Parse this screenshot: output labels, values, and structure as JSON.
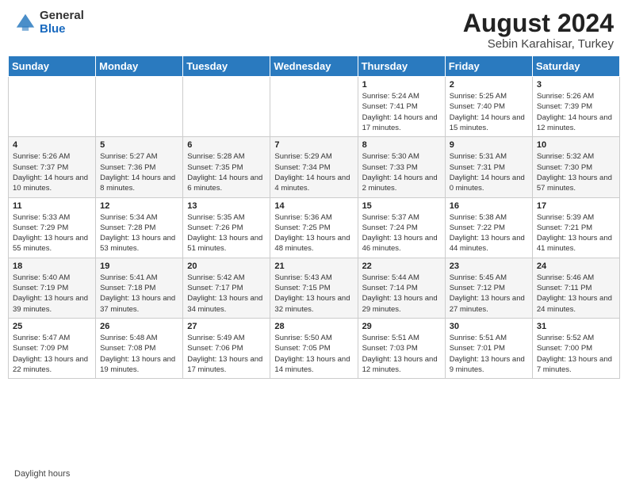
{
  "header": {
    "logo_general": "General",
    "logo_blue": "Blue",
    "month_year": "August 2024",
    "location": "Sebin Karahisar, Turkey"
  },
  "days_of_week": [
    "Sunday",
    "Monday",
    "Tuesday",
    "Wednesday",
    "Thursday",
    "Friday",
    "Saturday"
  ],
  "weeks": [
    [
      {
        "day": "",
        "info": ""
      },
      {
        "day": "",
        "info": ""
      },
      {
        "day": "",
        "info": ""
      },
      {
        "day": "",
        "info": ""
      },
      {
        "day": "1",
        "info": "Sunrise: 5:24 AM\nSunset: 7:41 PM\nDaylight: 14 hours and 17 minutes."
      },
      {
        "day": "2",
        "info": "Sunrise: 5:25 AM\nSunset: 7:40 PM\nDaylight: 14 hours and 15 minutes."
      },
      {
        "day": "3",
        "info": "Sunrise: 5:26 AM\nSunset: 7:39 PM\nDaylight: 14 hours and 12 minutes."
      }
    ],
    [
      {
        "day": "4",
        "info": "Sunrise: 5:26 AM\nSunset: 7:37 PM\nDaylight: 14 hours and 10 minutes."
      },
      {
        "day": "5",
        "info": "Sunrise: 5:27 AM\nSunset: 7:36 PM\nDaylight: 14 hours and 8 minutes."
      },
      {
        "day": "6",
        "info": "Sunrise: 5:28 AM\nSunset: 7:35 PM\nDaylight: 14 hours and 6 minutes."
      },
      {
        "day": "7",
        "info": "Sunrise: 5:29 AM\nSunset: 7:34 PM\nDaylight: 14 hours and 4 minutes."
      },
      {
        "day": "8",
        "info": "Sunrise: 5:30 AM\nSunset: 7:33 PM\nDaylight: 14 hours and 2 minutes."
      },
      {
        "day": "9",
        "info": "Sunrise: 5:31 AM\nSunset: 7:31 PM\nDaylight: 14 hours and 0 minutes."
      },
      {
        "day": "10",
        "info": "Sunrise: 5:32 AM\nSunset: 7:30 PM\nDaylight: 13 hours and 57 minutes."
      }
    ],
    [
      {
        "day": "11",
        "info": "Sunrise: 5:33 AM\nSunset: 7:29 PM\nDaylight: 13 hours and 55 minutes."
      },
      {
        "day": "12",
        "info": "Sunrise: 5:34 AM\nSunset: 7:28 PM\nDaylight: 13 hours and 53 minutes."
      },
      {
        "day": "13",
        "info": "Sunrise: 5:35 AM\nSunset: 7:26 PM\nDaylight: 13 hours and 51 minutes."
      },
      {
        "day": "14",
        "info": "Sunrise: 5:36 AM\nSunset: 7:25 PM\nDaylight: 13 hours and 48 minutes."
      },
      {
        "day": "15",
        "info": "Sunrise: 5:37 AM\nSunset: 7:24 PM\nDaylight: 13 hours and 46 minutes."
      },
      {
        "day": "16",
        "info": "Sunrise: 5:38 AM\nSunset: 7:22 PM\nDaylight: 13 hours and 44 minutes."
      },
      {
        "day": "17",
        "info": "Sunrise: 5:39 AM\nSunset: 7:21 PM\nDaylight: 13 hours and 41 minutes."
      }
    ],
    [
      {
        "day": "18",
        "info": "Sunrise: 5:40 AM\nSunset: 7:19 PM\nDaylight: 13 hours and 39 minutes."
      },
      {
        "day": "19",
        "info": "Sunrise: 5:41 AM\nSunset: 7:18 PM\nDaylight: 13 hours and 37 minutes."
      },
      {
        "day": "20",
        "info": "Sunrise: 5:42 AM\nSunset: 7:17 PM\nDaylight: 13 hours and 34 minutes."
      },
      {
        "day": "21",
        "info": "Sunrise: 5:43 AM\nSunset: 7:15 PM\nDaylight: 13 hours and 32 minutes."
      },
      {
        "day": "22",
        "info": "Sunrise: 5:44 AM\nSunset: 7:14 PM\nDaylight: 13 hours and 29 minutes."
      },
      {
        "day": "23",
        "info": "Sunrise: 5:45 AM\nSunset: 7:12 PM\nDaylight: 13 hours and 27 minutes."
      },
      {
        "day": "24",
        "info": "Sunrise: 5:46 AM\nSunset: 7:11 PM\nDaylight: 13 hours and 24 minutes."
      }
    ],
    [
      {
        "day": "25",
        "info": "Sunrise: 5:47 AM\nSunset: 7:09 PM\nDaylight: 13 hours and 22 minutes."
      },
      {
        "day": "26",
        "info": "Sunrise: 5:48 AM\nSunset: 7:08 PM\nDaylight: 13 hours and 19 minutes."
      },
      {
        "day": "27",
        "info": "Sunrise: 5:49 AM\nSunset: 7:06 PM\nDaylight: 13 hours and 17 minutes."
      },
      {
        "day": "28",
        "info": "Sunrise: 5:50 AM\nSunset: 7:05 PM\nDaylight: 13 hours and 14 minutes."
      },
      {
        "day": "29",
        "info": "Sunrise: 5:51 AM\nSunset: 7:03 PM\nDaylight: 13 hours and 12 minutes."
      },
      {
        "day": "30",
        "info": "Sunrise: 5:51 AM\nSunset: 7:01 PM\nDaylight: 13 hours and 9 minutes."
      },
      {
        "day": "31",
        "info": "Sunrise: 5:52 AM\nSunset: 7:00 PM\nDaylight: 13 hours and 7 minutes."
      }
    ]
  ],
  "footer": {
    "daylight_label": "Daylight hours"
  }
}
